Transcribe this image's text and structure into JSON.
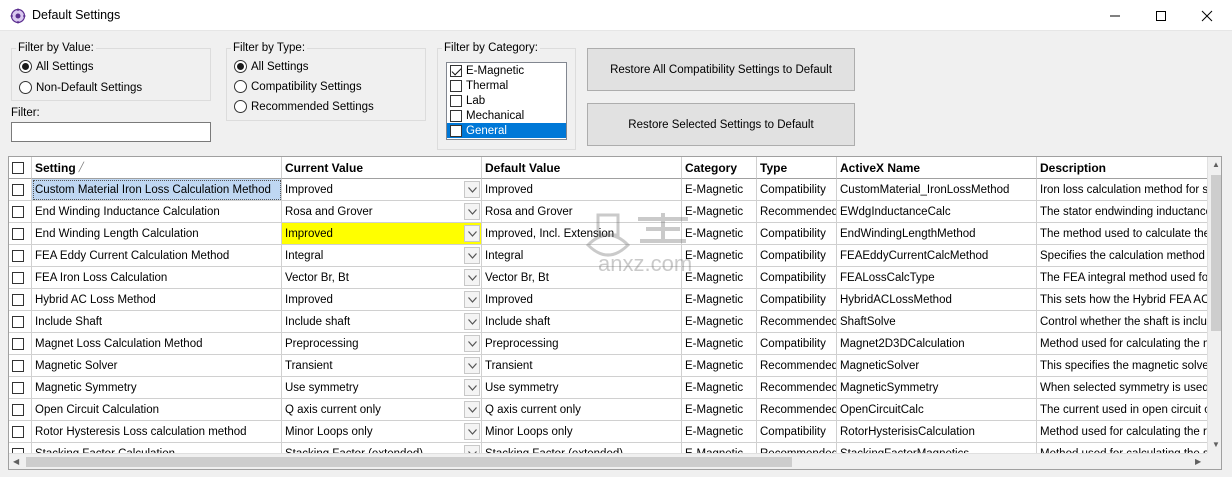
{
  "window": {
    "title": "Default Settings"
  },
  "filter_by_value": {
    "legend": "Filter by Value:",
    "options": [
      {
        "label": "All Settings",
        "selected": true
      },
      {
        "label": "Non-Default Settings",
        "selected": false
      }
    ]
  },
  "filter_by_type": {
    "legend": "Filter by Type:",
    "options": [
      {
        "label": "All Settings",
        "selected": true
      },
      {
        "label": "Compatibility Settings",
        "selected": false
      },
      {
        "label": "Recommended Settings",
        "selected": false
      }
    ]
  },
  "filter_by_category": {
    "legend": "Filter by Category:",
    "items": [
      {
        "label": "E-Magnetic",
        "checked": true,
        "selected": false
      },
      {
        "label": "Thermal",
        "checked": false,
        "selected": false
      },
      {
        "label": "Lab",
        "checked": false,
        "selected": false
      },
      {
        "label": "Mechanical",
        "checked": false,
        "selected": false
      },
      {
        "label": "General",
        "checked": false,
        "selected": true
      }
    ]
  },
  "filter": {
    "label": "Filter:",
    "value": ""
  },
  "buttons": {
    "restore_all": "Restore All Compatibility Settings to Default",
    "restore_selected": "Restore Selected Settings to Default"
  },
  "grid": {
    "columns": [
      "Setting",
      "Current Value",
      "Default Value",
      "Category",
      "Type",
      "ActiveX Name",
      "Description"
    ],
    "rows": [
      {
        "setting": "Custom Material Iron Loss Calculation Method",
        "current": "Improved",
        "default": "Improved",
        "category": "E-Magnetic",
        "type": "Compatibility",
        "activex": "CustomMaterial_IronLossMethod",
        "description": "Iron loss calculation method for steel"
      },
      {
        "setting": "End Winding Inductance Calculation",
        "current": "Rosa and Grover",
        "default": "Rosa and Grover",
        "category": "E-Magnetic",
        "type": "Recommended",
        "activex": "EWdgInductanceCalc",
        "description": "The stator endwinding inductance c"
      },
      {
        "setting": "End Winding Length Calculation",
        "current": "Improved",
        "default": "Improved, Incl. Extension",
        "category": "E-Magnetic",
        "type": "Compatibility",
        "activex": "EndWindingLengthMethod",
        "description": "The method used to calculate the st"
      },
      {
        "setting": "FEA Eddy Current Calculation Method",
        "current": "Integral",
        "default": "Integral",
        "category": "E-Magnetic",
        "type": "Compatibility",
        "activex": "FEAEddyCurrentCalcMethod",
        "description": "Specifies the calculation method for"
      },
      {
        "setting": "FEA Iron Loss Calculation",
        "current": "Vector Br, Bt",
        "default": "Vector Br, Bt",
        "category": "E-Magnetic",
        "type": "Compatibility",
        "activex": "FEALossCalcType",
        "description": "The FEA integral method used for B"
      },
      {
        "setting": "Hybrid AC Loss Method",
        "current": "Improved",
        "default": "Improved",
        "category": "E-Magnetic",
        "type": "Compatibility",
        "activex": "HybridACLossMethod",
        "description": "This sets how the Hybrid FEA AC lo"
      },
      {
        "setting": "Include Shaft",
        "current": "Include shaft",
        "default": "Include shaft",
        "category": "E-Magnetic",
        "type": "Recommended",
        "activex": "ShaftSolve",
        "description": "Control whether the shaft is include"
      },
      {
        "setting": "Magnet Loss Calculation Method",
        "current": "Preprocessing",
        "default": "Preprocessing",
        "category": "E-Magnetic",
        "type": "Compatibility",
        "activex": "Magnet2D3DCalculation",
        "description": "Method used for calculating the ma"
      },
      {
        "setting": "Magnetic Solver",
        "current": "Transient",
        "default": "Transient",
        "category": "E-Magnetic",
        "type": "Recommended",
        "activex": "MagneticSolver",
        "description": "This specifies the magnetic solver to"
      },
      {
        "setting": "Magnetic Symmetry",
        "current": "Use symmetry",
        "default": "Use symmetry",
        "category": "E-Magnetic",
        "type": "Recommended",
        "activex": "MagneticSymmetry",
        "description": "When selected symmetry is used to"
      },
      {
        "setting": "Open Circuit Calculation",
        "current": "Q axis current only",
        "default": "Q axis current only",
        "category": "E-Magnetic",
        "type": "Recommended",
        "activex": "OpenCircuitCalc",
        "description": "The current used in open circuit ope"
      },
      {
        "setting": "Rotor Hysteresis Loss calculation method",
        "current": "Minor Loops only",
        "default": "Minor Loops only",
        "category": "E-Magnetic",
        "type": "Compatibility",
        "activex": "RotorHysterisisCalculation",
        "description": "Method used for calculating the roto"
      },
      {
        "setting": "Stacking Factor Calculation",
        "current": "Stacking Factor (extended)",
        "default": "Stacking Factor (extended)",
        "category": "E-Magnetic",
        "type": "Recommended",
        "activex": "StackingFactorMagnetics",
        "description": "Method used for calculating the stack"
      }
    ]
  },
  "colors": {
    "selected_row": "#bfd7f2",
    "changed_value": "#ffff00",
    "list_selection": "#0078d7"
  },
  "watermark": {
    "text": "anxz.com"
  }
}
